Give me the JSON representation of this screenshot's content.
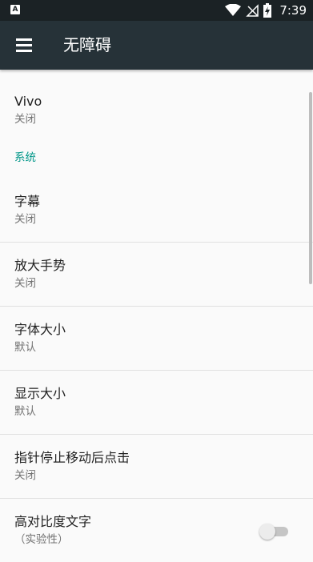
{
  "status_bar": {
    "app_notification_icon": "A",
    "time": "7:39",
    "icons": [
      "wifi-icon",
      "signal-off-icon",
      "battery-charging-icon"
    ]
  },
  "app_bar": {
    "menu_icon": "menu-icon",
    "title": "无障碍"
  },
  "services": [
    {
      "title": "Vivo",
      "summary": "关闭"
    }
  ],
  "system": {
    "header": "系统",
    "items": [
      {
        "title": "字幕",
        "summary": "关闭"
      },
      {
        "title": "放大手势",
        "summary": "关闭"
      },
      {
        "title": "字体大小",
        "summary": "默认"
      },
      {
        "title": "显示大小",
        "summary": "默认"
      },
      {
        "title": "指针停止移动后点击",
        "summary": "关闭"
      },
      {
        "title": "高对比度文字",
        "summary": "（实验性）",
        "toggle": "off"
      }
    ]
  },
  "colors": {
    "app_bar": "#263238",
    "status_bar": "#1b2225",
    "accent": "#009688"
  }
}
